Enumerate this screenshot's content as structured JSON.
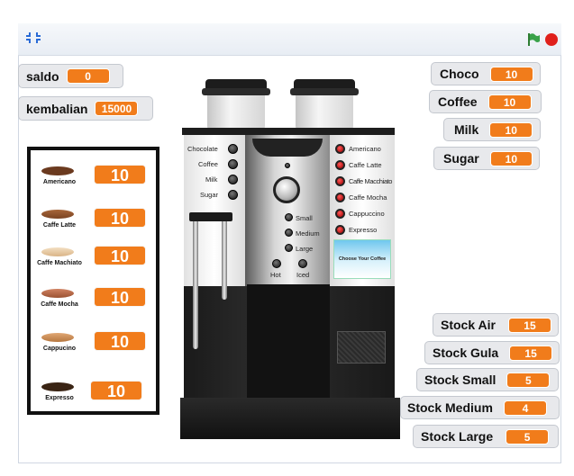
{
  "topbar": {
    "left_icon": "fullscreen-toggle-icon",
    "green_flag_icon": "green-flag-icon",
    "stop_icon": "stop-sign-icon"
  },
  "variables": {
    "saldo": {
      "label": "saldo",
      "value": "0"
    },
    "kembalian": {
      "label": "kembalian",
      "value": "15000"
    },
    "choco": {
      "label": "Choco",
      "value": "10"
    },
    "coffee": {
      "label": "Coffee",
      "value": "10"
    },
    "milk": {
      "label": "Milk",
      "value": "10"
    },
    "sugar": {
      "label": "Sugar",
      "value": "10"
    },
    "stock_air": {
      "label": "Stock Air",
      "value": "15"
    },
    "stock_gula": {
      "label": "Stock Gula",
      "value": "15"
    },
    "stock_small": {
      "label": "Stock Small",
      "value": "5"
    },
    "stock_medium": {
      "label": "Stock Medium",
      "value": "4"
    },
    "stock_large": {
      "label": "Stock Large",
      "value": "5"
    }
  },
  "menu": [
    {
      "name": "Americano",
      "value": "10",
      "color": "#6b3a1f"
    },
    {
      "name": "Caffe Latte",
      "value": "10",
      "color": "#a8663a"
    },
    {
      "name": "Caffe Machiato",
      "value": "10",
      "color": "#e8c9a4"
    },
    {
      "name": "Caffe Mocha",
      "value": "10",
      "color": "#b96a4a"
    },
    {
      "name": "Cappucino",
      "value": "10",
      "color": "#c98a55"
    },
    {
      "name": "Expresso",
      "value": "10",
      "color": "#3a2414"
    }
  ],
  "machine": {
    "ingredients": [
      "Chocolate",
      "Coffee",
      "Milk",
      "Sugar"
    ],
    "sizes": [
      "Small",
      "Medium",
      "Large"
    ],
    "temps": [
      "Hot",
      "Iced"
    ],
    "drinks": [
      "Americano",
      "Caffe Latte",
      "Caffe Macchiato",
      "Caffe Mocha",
      "Cappuccino",
      "Expresso"
    ],
    "screen_text": "Choose Your Coffee"
  }
}
